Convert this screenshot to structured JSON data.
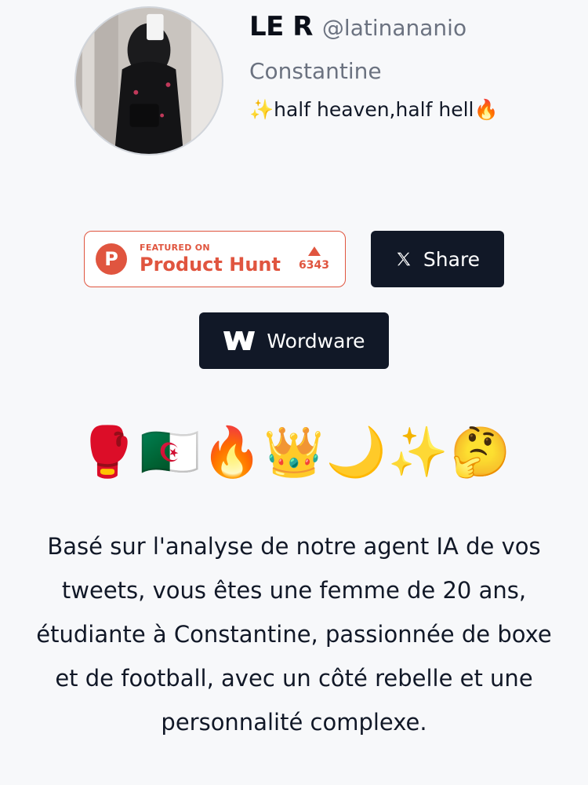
{
  "profile": {
    "display_name": "LE R",
    "handle": "@latinananio",
    "location": "Constantine",
    "bio": "✨half heaven,half hell🔥"
  },
  "buttons": {
    "product_hunt": {
      "featured_on": "FEATURED ON",
      "name": "Product Hunt",
      "votes": "6343",
      "color": "#e0553f"
    },
    "share_label": "Share",
    "wordware_label": "Wordware"
  },
  "emojis": [
    "🥊",
    "🇩🇿",
    "🔥",
    "👑",
    "🌙",
    "✨",
    "🤔"
  ],
  "analysis_text": "Basé sur l'analyse de notre agent IA de vos tweets, vous êtes une femme de 20 ans, étudiante à Constantine, passionnée de boxe et de football, avec un côté rebelle et une personnalité complexe."
}
